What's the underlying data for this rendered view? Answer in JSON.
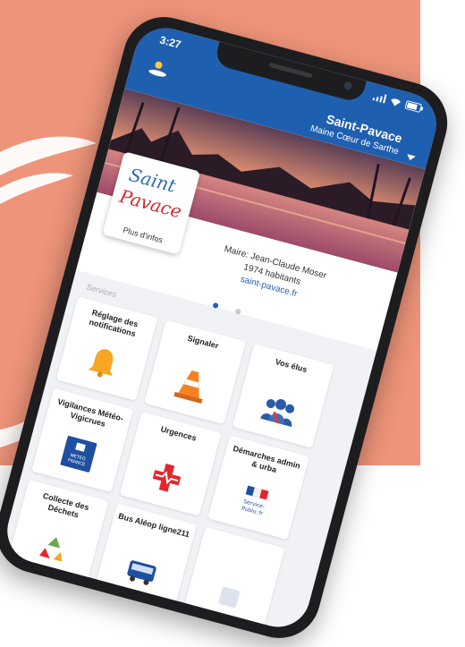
{
  "status_bar": {
    "time": "3:27"
  },
  "header": {
    "commune_name": "Saint-Pavace",
    "commune_subtitle": "Maine Cœur de Sarthe"
  },
  "logo": {
    "line1": "Saint",
    "line2": "Pavace",
    "button_label": "Plus d'infos"
  },
  "commune_info": {
    "mayor": "Maire: Jean-Claude Moser",
    "population": "1974 habitants",
    "website": "saint-pavace.fr"
  },
  "carousel": {
    "pages": 2,
    "active_page": 1
  },
  "services": {
    "section_label": "Services",
    "tiles": [
      {
        "label": "Réglage des notifications",
        "icon": "bell-icon"
      },
      {
        "label": "Signaler",
        "icon": "traffic-cone-icon"
      },
      {
        "label": "Vos élus",
        "icon": "elected-officials-icon"
      },
      {
        "label": "Vigilances Météo-Vigicrues",
        "icon": "meteo-france-icon",
        "icon_text": "METEO FRANCE"
      },
      {
        "label": "Urgences",
        "icon": "emergency-cross-icon"
      },
      {
        "label": "Démarches admin & urba",
        "icon": "service-public-icon",
        "icon_text": "Service-Public.fr"
      },
      {
        "label": "Collecte des Déchets",
        "icon": "recycling-icon"
      },
      {
        "label": "Bus Aléop ligne211",
        "icon": "bus-icon"
      },
      {
        "label": "",
        "icon": "tile-icon"
      }
    ]
  },
  "colors": {
    "background_panel": "#ee947a",
    "header_blue": "#1f5fb0",
    "logo_blue": "#2a6ab6",
    "logo_red": "#d8262e"
  }
}
